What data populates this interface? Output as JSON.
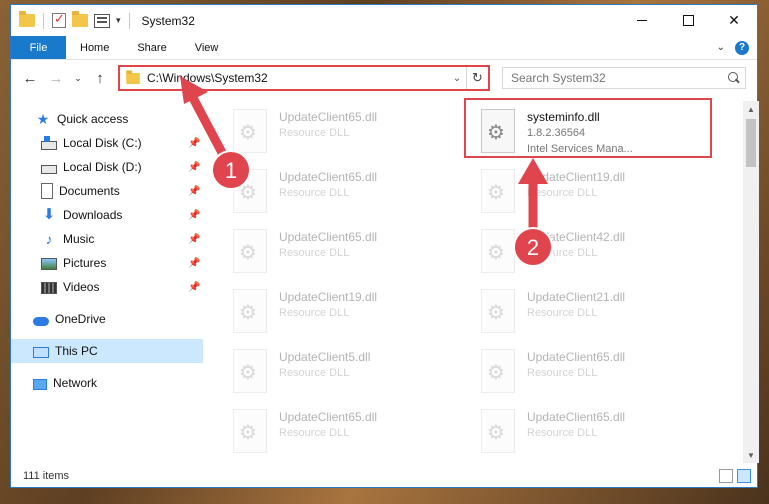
{
  "window": {
    "title": "System32",
    "controls": {
      "minimize": "",
      "maximize": "",
      "close": "✕"
    }
  },
  "ribbon": {
    "file": "File",
    "tabs": [
      "Home",
      "Share",
      "View"
    ]
  },
  "address": {
    "path": "C:\\Windows\\System32",
    "search_placeholder": "Search System32"
  },
  "nav": {
    "items": [
      {
        "label": "Quick access",
        "icon": "star-icon",
        "pinned": false
      },
      {
        "label": "Local Disk (C:)",
        "icon": "drive-c-icon",
        "pinned": true
      },
      {
        "label": "Local Disk (D:)",
        "icon": "drive-icon",
        "pinned": true
      },
      {
        "label": "Documents",
        "icon": "documents-icon",
        "pinned": true
      },
      {
        "label": "Downloads",
        "icon": "downloads-icon",
        "pinned": true
      },
      {
        "label": "Music",
        "icon": "music-icon",
        "pinned": true
      },
      {
        "label": "Pictures",
        "icon": "pictures-icon",
        "pinned": true
      },
      {
        "label": "Videos",
        "icon": "videos-icon",
        "pinned": true
      },
      {
        "label": "OneDrive",
        "icon": "onedrive-icon",
        "pinned": false
      },
      {
        "label": "This PC",
        "icon": "this-pc-icon",
        "pinned": false,
        "selected": true
      },
      {
        "label": "Network",
        "icon": "network-icon",
        "pinned": false
      }
    ]
  },
  "files": {
    "left": [
      {
        "name": "UpdateClient65.dll",
        "type": "Resource DLL"
      },
      {
        "name": "UpdateClient65.dll",
        "type": "Resource DLL"
      },
      {
        "name": "UpdateClient65.dll",
        "type": "Resource DLL"
      },
      {
        "name": "UpdateClient19.dll",
        "type": "Resource DLL"
      },
      {
        "name": "UpdateClient5.dll",
        "type": "Resource DLL"
      },
      {
        "name": "UpdateClient65.dll",
        "type": "Resource DLL"
      }
    ],
    "right": [
      {
        "name": "systeminfo.dll",
        "version": "1.8.2.36564",
        "company": "Intel Services Mana...",
        "highlighted": true
      },
      {
        "name": "UpdateClient19.dll",
        "type": "Resource DLL"
      },
      {
        "name": "UpdateClient42.dll",
        "type": "Resource DLL"
      },
      {
        "name": "UpdateClient21.dll",
        "type": "Resource DLL"
      },
      {
        "name": "UpdateClient65.dll",
        "type": "Resource DLL"
      },
      {
        "name": "UpdateClient65.dll",
        "type": "Resource DLL"
      }
    ]
  },
  "status": {
    "item_count": "111 items"
  },
  "annotations": {
    "step1": "1",
    "step2": "2",
    "accent_color": "#e0444d"
  },
  "colors": {
    "accent": "#1979ca",
    "selection": "#cce8ff",
    "highlight_box": "#e0444d"
  }
}
